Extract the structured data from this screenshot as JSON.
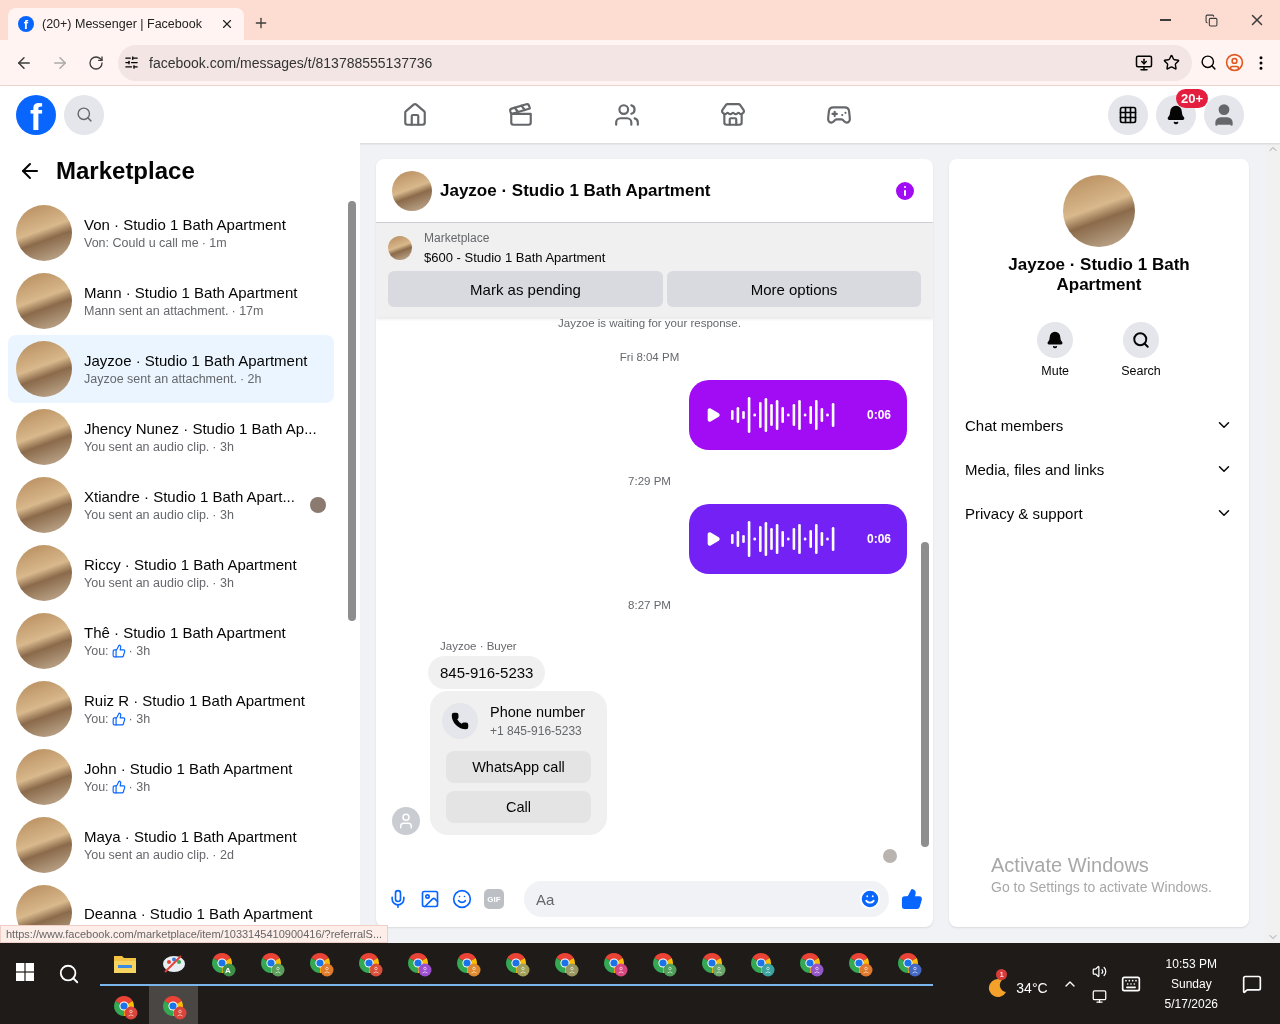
{
  "browser": {
    "favicon_letter": "f",
    "tab_title": "(20+) Messenger | Facebook",
    "url": "facebook.com/messages/t/813788555137736"
  },
  "header": {
    "logo_letter": "f",
    "notification_badge": "20+"
  },
  "sidebar": {
    "title": "Marketplace",
    "conversations": [
      {
        "name": "Von · Studio 1 Bath Apartment",
        "preview": "Von: Could u call me",
        "like": false,
        "time": "· 1m",
        "selected": false,
        "seen": false
      },
      {
        "name": "Mann · Studio 1 Bath Apartment",
        "preview": "Mann sent an attachment.",
        "like": false,
        "time": "· 17m",
        "selected": false,
        "seen": false
      },
      {
        "name": "Jayzoe · Studio 1 Bath Apartment",
        "preview": "Jayzoe sent an attachment.",
        "like": false,
        "time": "· 2h",
        "selected": true,
        "seen": false
      },
      {
        "name": "Jhency Nunez · Studio 1 Bath Ap...",
        "preview": "You sent an audio clip.",
        "like": false,
        "time": "· 3h",
        "selected": false,
        "seen": false
      },
      {
        "name": "Xtiandre · Studio 1 Bath Apart...",
        "preview": "You sent an audio clip.",
        "like": false,
        "time": "· 3h",
        "selected": false,
        "seen": true
      },
      {
        "name": "Riccy · Studio 1 Bath Apartment",
        "preview": "You sent an audio clip.",
        "like": false,
        "time": "· 3h",
        "selected": false,
        "seen": false
      },
      {
        "name": "Thê · Studio 1 Bath Apartment",
        "preview": "You:",
        "like": true,
        "time": "· 3h",
        "selected": false,
        "seen": false
      },
      {
        "name": "Ruiz R · Studio 1 Bath Apartment",
        "preview": "You:",
        "like": true,
        "time": "· 3h",
        "selected": false,
        "seen": false
      },
      {
        "name": "John · Studio 1 Bath Apartment",
        "preview": "You:",
        "like": true,
        "time": "· 3h",
        "selected": false,
        "seen": false
      },
      {
        "name": "Maya · Studio 1 Bath Apartment",
        "preview": "You sent an audio clip.",
        "like": false,
        "time": "· 2d",
        "selected": false,
        "seen": false
      },
      {
        "name": "Deanna · Studio 1 Bath Apartment",
        "like": false,
        "selected": false,
        "seen": false
      }
    ]
  },
  "status_link": "https://www.facebook.com/marketplace/item/1033145410900416/?referralS...",
  "chat": {
    "title": "Jayzoe · Studio 1 Bath Apartment",
    "listing": {
      "label": "Marketplace",
      "title": "$600 - Studio 1 Bath Apartment"
    },
    "buttons": [
      "Mark as pending",
      "More options"
    ],
    "messages": [
      {
        "kind": "notice",
        "text": "Jayzoe is waiting for your response."
      },
      {
        "kind": "time",
        "text": "Fri 8:04 PM"
      },
      {
        "kind": "audio",
        "duration": "0:06",
        "color": "#a20cf4"
      },
      {
        "kind": "time",
        "text": "7:29 PM"
      },
      {
        "kind": "audio",
        "duration": "0:06",
        "color": "#7421f6"
      },
      {
        "kind": "time",
        "text": "8:27 PM"
      },
      {
        "kind": "sender",
        "text": "Jayzoe · Buyer"
      },
      {
        "kind": "text",
        "text": "845-916-5233"
      },
      {
        "kind": "contact",
        "title": "Phone number",
        "number": "+1 845-916-5233",
        "buttons": [
          "WhatsApp call",
          "Call"
        ]
      }
    ],
    "composer": {
      "gif_label": "GIF",
      "placeholder": "Aa"
    }
  },
  "details": {
    "name": "Jayzoe · Studio 1 Bath Apartment",
    "actions": [
      {
        "kind": "mute",
        "label": "Mute"
      },
      {
        "kind": "search",
        "label": "Search"
      }
    ],
    "sections": [
      {
        "label": "Chat members",
        "expanded": false
      },
      {
        "label": "Media, files and links",
        "expanded": false
      },
      {
        "label": "Privacy & support",
        "expanded": false
      }
    ]
  },
  "windows_notice": {
    "title": "Activate Windows",
    "text": "Go to Settings to activate Windows."
  },
  "taskbar": {
    "apps": [
      {
        "kind": "explorer",
        "selected": false
      },
      {
        "kind": "paint",
        "selected": false
      },
      {
        "kind": "chrome",
        "badge": "A",
        "color": "#3f8f48",
        "selected": false
      },
      {
        "kind": "chrome",
        "color": "#5b9f5b",
        "selected": false
      },
      {
        "kind": "chrome",
        "color": "#e07b2c",
        "selected": false
      },
      {
        "kind": "chrome",
        "color": "#d9503a",
        "selected": false
      },
      {
        "kind": "chrome",
        "color": "#9c4fd0",
        "selected": false
      },
      {
        "kind": "chrome",
        "color": "#e08a30",
        "selected": false
      },
      {
        "kind": "chrome",
        "color": "#a3a05a",
        "selected": false
      },
      {
        "kind": "chrome",
        "color": "#9a9860",
        "selected": false
      },
      {
        "kind": "chrome",
        "color": "#d6477f",
        "selected": false
      },
      {
        "kind": "chrome",
        "color": "#4f9e59",
        "selected": false
      },
      {
        "kind": "chrome",
        "color": "#6aa56a",
        "selected": false
      },
      {
        "kind": "chrome",
        "color": "#3aa3a0",
        "selected": false
      },
      {
        "kind": "chrome",
        "color": "#9457c8",
        "selected": false
      },
      {
        "kind": "chrome",
        "color": "#e0792e",
        "selected": false
      },
      {
        "kind": "chrome",
        "color": "#4468c4",
        "selected": false
      },
      {
        "kind": "chrome",
        "color": "#d9453a",
        "selected": false
      },
      {
        "kind": "chrome",
        "color": "#d9453a",
        "selected": true
      }
    ],
    "weather": {
      "badge": "1",
      "temperature": "34°C"
    },
    "clock": {
      "time": "10:53 PM",
      "day": "Sunday",
      "date": "5/17/2026"
    }
  }
}
